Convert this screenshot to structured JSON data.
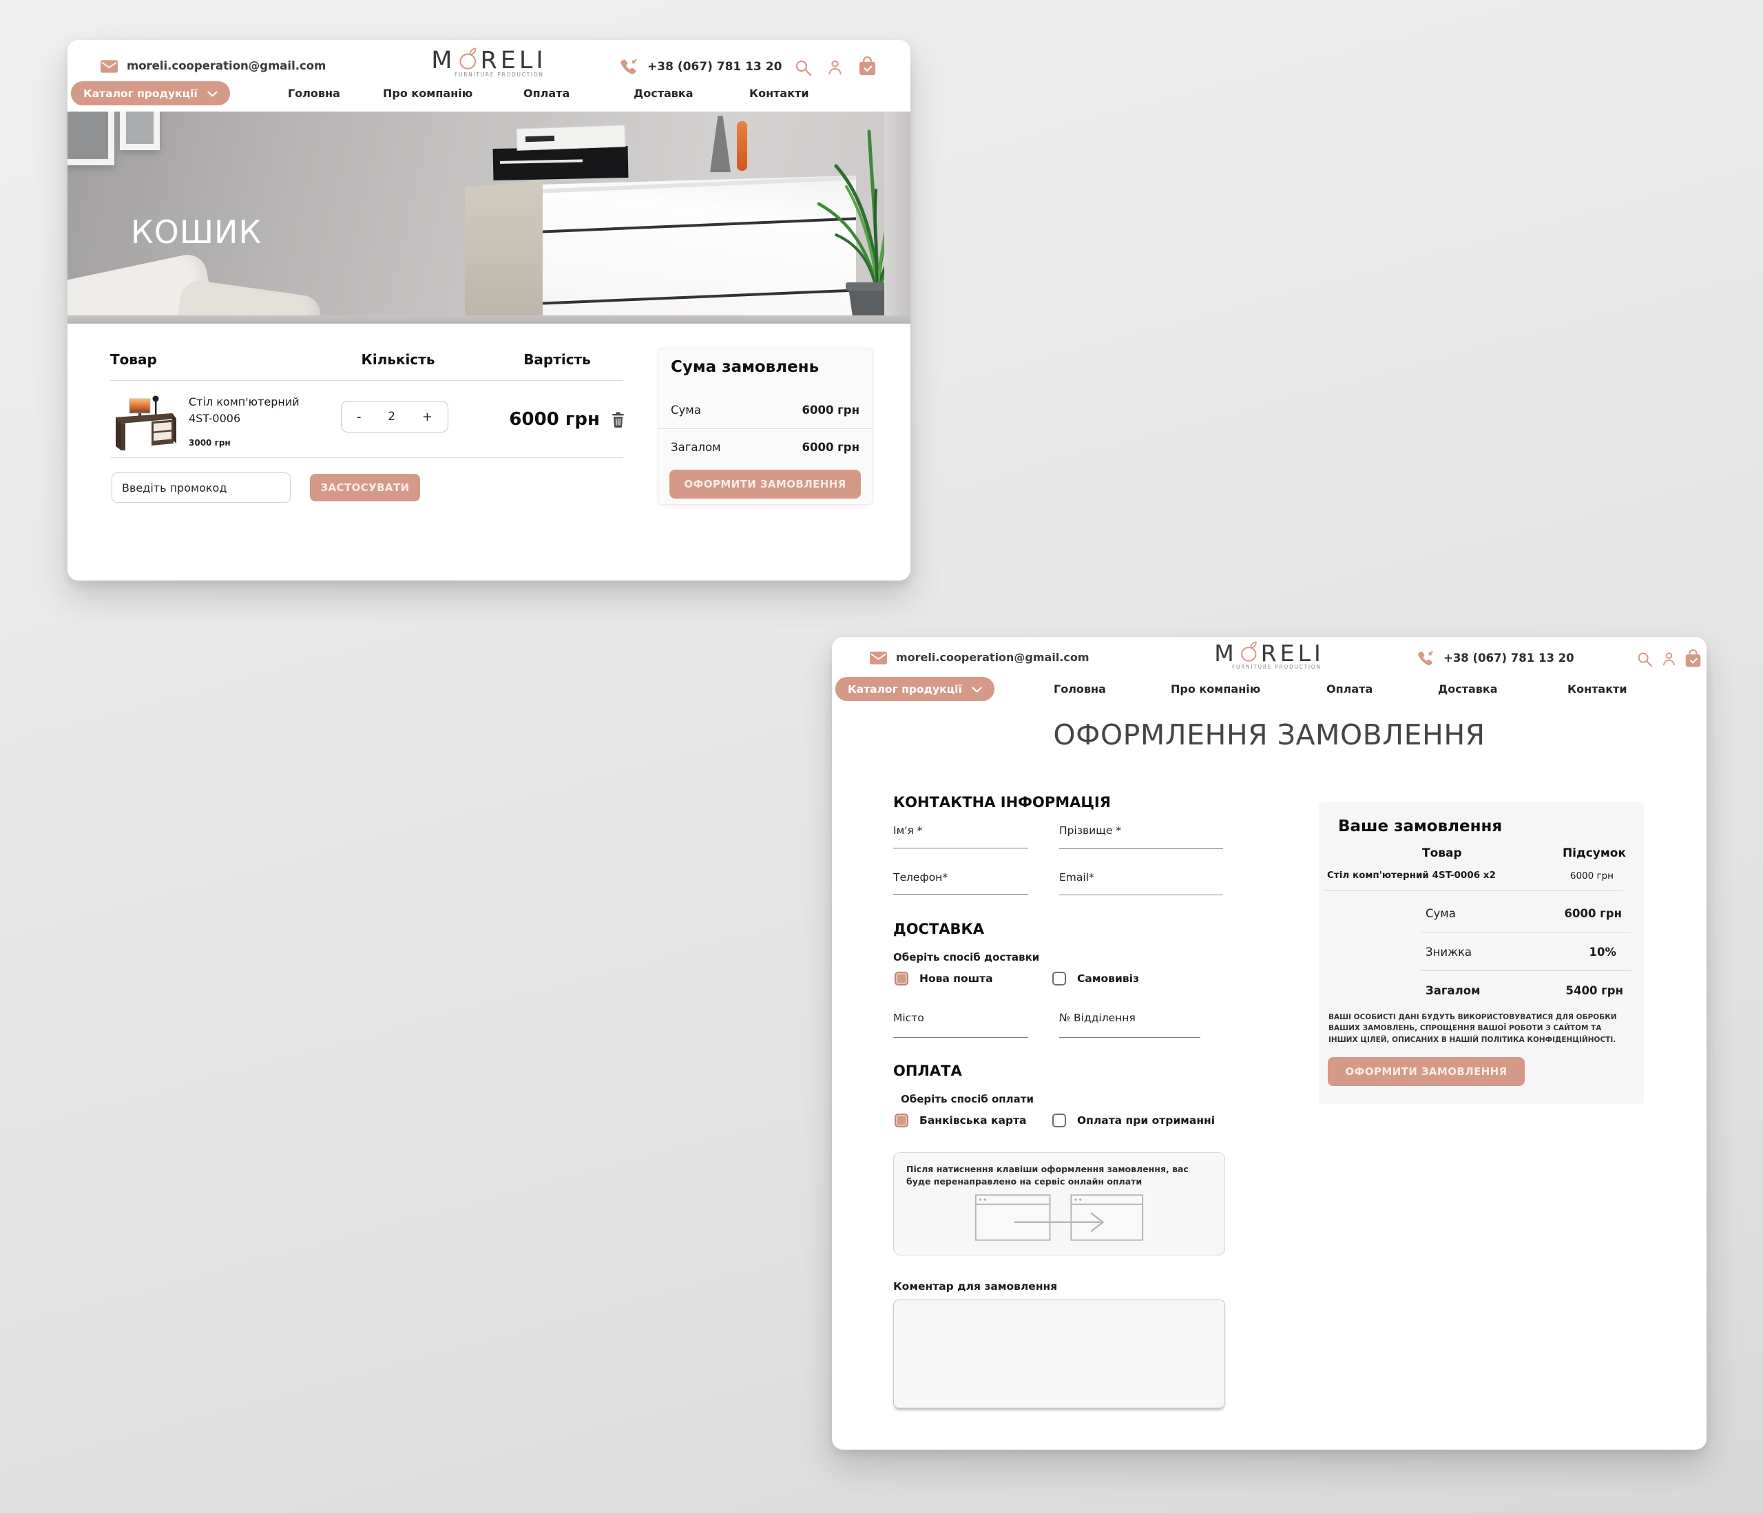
{
  "brand": {
    "logo_left": "M",
    "logo_right": "RELI",
    "tagline": "FURNITURE PRODUCTION"
  },
  "header": {
    "email": "moreli.cooperation@gmail.com",
    "phone": "+38 (067) 781 13 20"
  },
  "nav": {
    "catalog": "Каталог продукції",
    "items": [
      "Головна",
      "Про компанію",
      "Оплата",
      "Доставка",
      "Контакти"
    ]
  },
  "cart": {
    "hero_title": "КОШИК",
    "columns": {
      "product": "Товар",
      "quantity": "Кількість",
      "cost": "Вартість"
    },
    "item": {
      "name": "Стіл комп'ютерний 4ST-0006",
      "unit_price": "3000 грн",
      "minus": "-",
      "quantity": "2",
      "plus": "+",
      "total": "6000 грн"
    },
    "promo": {
      "placeholder": "Введіть промокод",
      "apply": "ЗАСТОСУВАТИ"
    },
    "summary": {
      "title": "Сума замовлень",
      "sum_label": "Сума",
      "sum_value": "6000 грн",
      "total_label": "Загалом",
      "total_value": "6000 грн",
      "checkout": "ОФОРМИТИ ЗАМОВЛЕННЯ"
    }
  },
  "checkout": {
    "title": "ОФОРМЛЕННЯ ЗАМОВЛЕННЯ",
    "contact": {
      "heading": "КОНТАКТНА ІНФОРМАЦІЯ",
      "first_name": "Ім'я *",
      "last_name": "Прізвище *",
      "phone": "Телефон*",
      "email": "Email*"
    },
    "delivery": {
      "heading": "ДОСТАВКА",
      "hint": "Оберіть спосіб доставки",
      "nova_poshta": "Нова пошта",
      "pickup": "Самовивіз",
      "city": "Місто",
      "branch": "№ Відділення"
    },
    "payment": {
      "heading": "ОПЛАТА",
      "hint": "Оберіть спосіб оплати",
      "card": "Банківська карта",
      "on_delivery": "Оплата при отриманні",
      "redirect_note": "Після натиснення клавіши оформлення замовлення, вас буде перенаправлено на сервіс онлайн оплати"
    },
    "comment_label": "Коментар для замовлення",
    "order": {
      "title": "Ваше замовлення",
      "col_product": "Товар",
      "col_subtotal": "Підсумок",
      "item_name": "Стіл комп'ютерний 4ST-0006 х2",
      "item_total": "6000 грн",
      "sum_label": "Сума",
      "sum_value": "6000 грн",
      "discount_label": "Знижка",
      "discount_value": "10%",
      "total_label": "Загалом",
      "total_value": "5400 грн",
      "privacy": "ВАШІ ОСОБИСТІ ДАНІ БУДУТЬ ВИКОРИСТОВУВАТИСЯ ДЛЯ ОБРОБКИ ВАШИХ ЗАМОВЛЕНЬ, СПРОЩЕННЯ ВАШОЇ РОБОТИ З САЙТОМ ТА ІНШИХ ЦІЛЕЙ, ОПИСАНИХ В НАШІЙ ПОЛІТИКА КОНФІДЕНЦІЙНОСТІ.",
      "checkout": "ОФОРМИТИ ЗАМОВЛЕННЯ"
    }
  },
  "colors": {
    "accent": "#D59A87"
  }
}
